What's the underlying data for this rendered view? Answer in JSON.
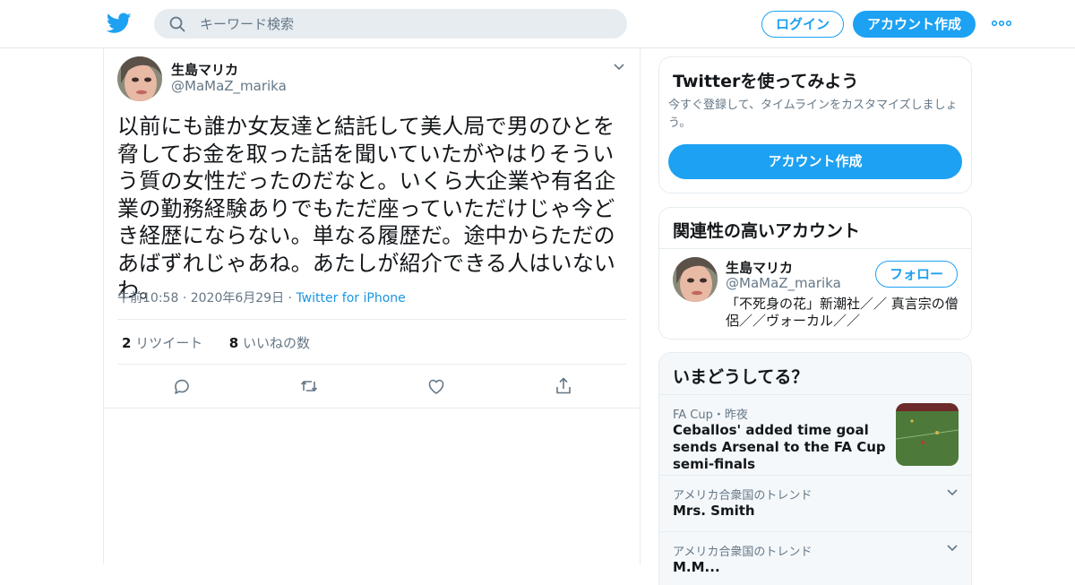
{
  "header": {
    "search_placeholder": "キーワード検索",
    "login_label": "ログイン",
    "signup_label": "アカウント作成",
    "brand_color": "#1da1f2"
  },
  "tweet": {
    "display_name": "生島マリカ",
    "handle": "@MaMaZ_marika",
    "text": "以前にも誰か女友達と結託して美人局で男のひとを脅してお金を取った話を聞いていたがやはりそういう質の女性だったのだなと。いくら大企業や有名企業の勤務経験ありでもただ座っていただけじゃ今どき経歴にならない。単なる履歴だ。途中からただのあばずれじゃあね。あたしが紹介できる人はいないわ。",
    "time": "午前10:58",
    "date": "2020年6月29日",
    "source": "Twitter for iPhone",
    "retweet_count": "2",
    "retweet_label": "リツイート",
    "like_count": "8",
    "like_label": "いいねの数"
  },
  "sidebar": {
    "signup_card": {
      "title": "Twitterを使ってみよう",
      "subtitle": "今すぐ登録して、タイムラインをカスタマイズしましょう。",
      "button_label": "アカウント作成"
    },
    "relevant": {
      "title": "関連性の高いアカウント",
      "account": {
        "name": "生島マリカ",
        "handle": "@MaMaZ_marika",
        "follow_label": "フォロー",
        "bio": "「不死身の花」新潮社／／ 真言宗の僧侶／／ヴォーカル／／"
      }
    },
    "trends": {
      "title": "いまどうしてる？",
      "items": [
        {
          "meta": "FA Cup・昨夜",
          "title": "Ceballos' added time goal sends Arsenal to the FA Cup semi-finals"
        },
        {
          "meta": "アメリカ合衆国のトレンド",
          "title": "Mrs. Smith"
        },
        {
          "meta": "アメリカ合衆国のトレンド",
          "title": "M.M..."
        }
      ]
    }
  }
}
